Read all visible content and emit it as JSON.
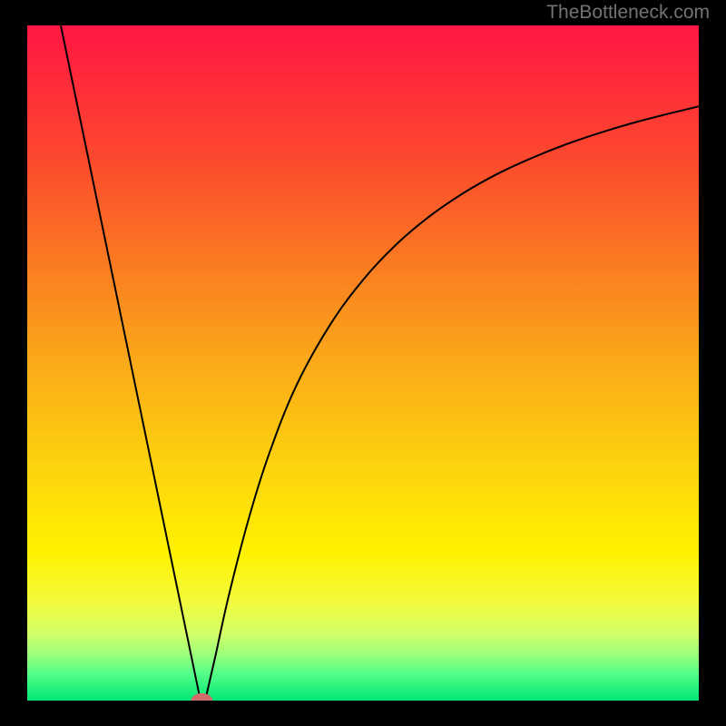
{
  "watermark": "TheBottleneck.com",
  "chart_data": {
    "type": "line",
    "title": "",
    "xlabel": "",
    "ylabel": "",
    "xlim": [
      0,
      100
    ],
    "ylim": [
      0,
      100
    ],
    "grid": false,
    "legend": false,
    "gradient_bands": [
      {
        "offset": 0.0,
        "color": "#ff1744"
      },
      {
        "offset": 0.08,
        "color": "#ff2a3a"
      },
      {
        "offset": 0.2,
        "color": "#fc4a2d"
      },
      {
        "offset": 0.35,
        "color": "#fa7a22"
      },
      {
        "offset": 0.5,
        "color": "#fbaa19"
      },
      {
        "offset": 0.65,
        "color": "#fdd20e"
      },
      {
        "offset": 0.78,
        "color": "#fff200"
      },
      {
        "offset": 0.85,
        "color": "#f4fa3a"
      },
      {
        "offset": 0.9,
        "color": "#d3ff66"
      },
      {
        "offset": 0.93,
        "color": "#9fff7a"
      },
      {
        "offset": 0.96,
        "color": "#55ff88"
      },
      {
        "offset": 1.0,
        "color": "#00e676"
      }
    ],
    "series": [
      {
        "name": "left-leg",
        "type": "line",
        "points": [
          {
            "x": 5.0,
            "y": 100.0
          },
          {
            "x": 25.8,
            "y": 0.0
          }
        ]
      },
      {
        "name": "right-curve",
        "type": "line",
        "points": [
          {
            "x": 26.5,
            "y": 0.0
          },
          {
            "x": 28.0,
            "y": 6.5
          },
          {
            "x": 30.0,
            "y": 15.5
          },
          {
            "x": 33.0,
            "y": 27.0
          },
          {
            "x": 36.0,
            "y": 36.5
          },
          {
            "x": 40.0,
            "y": 46.5
          },
          {
            "x": 45.0,
            "y": 55.5
          },
          {
            "x": 50.0,
            "y": 62.3
          },
          {
            "x": 55.0,
            "y": 67.6
          },
          {
            "x": 60.0,
            "y": 71.8
          },
          {
            "x": 65.0,
            "y": 75.2
          },
          {
            "x": 70.0,
            "y": 78.0
          },
          {
            "x": 75.0,
            "y": 80.3
          },
          {
            "x": 80.0,
            "y": 82.3
          },
          {
            "x": 85.0,
            "y": 84.0
          },
          {
            "x": 90.0,
            "y": 85.5
          },
          {
            "x": 95.0,
            "y": 86.8
          },
          {
            "x": 100.0,
            "y": 88.0
          }
        ]
      }
    ],
    "markers": [
      {
        "name": "min-marker",
        "x": 26.0,
        "y": 0.0,
        "shape": "ellipse",
        "rx": 1.6,
        "ry": 1.1,
        "color": "#d36b6b"
      }
    ]
  }
}
